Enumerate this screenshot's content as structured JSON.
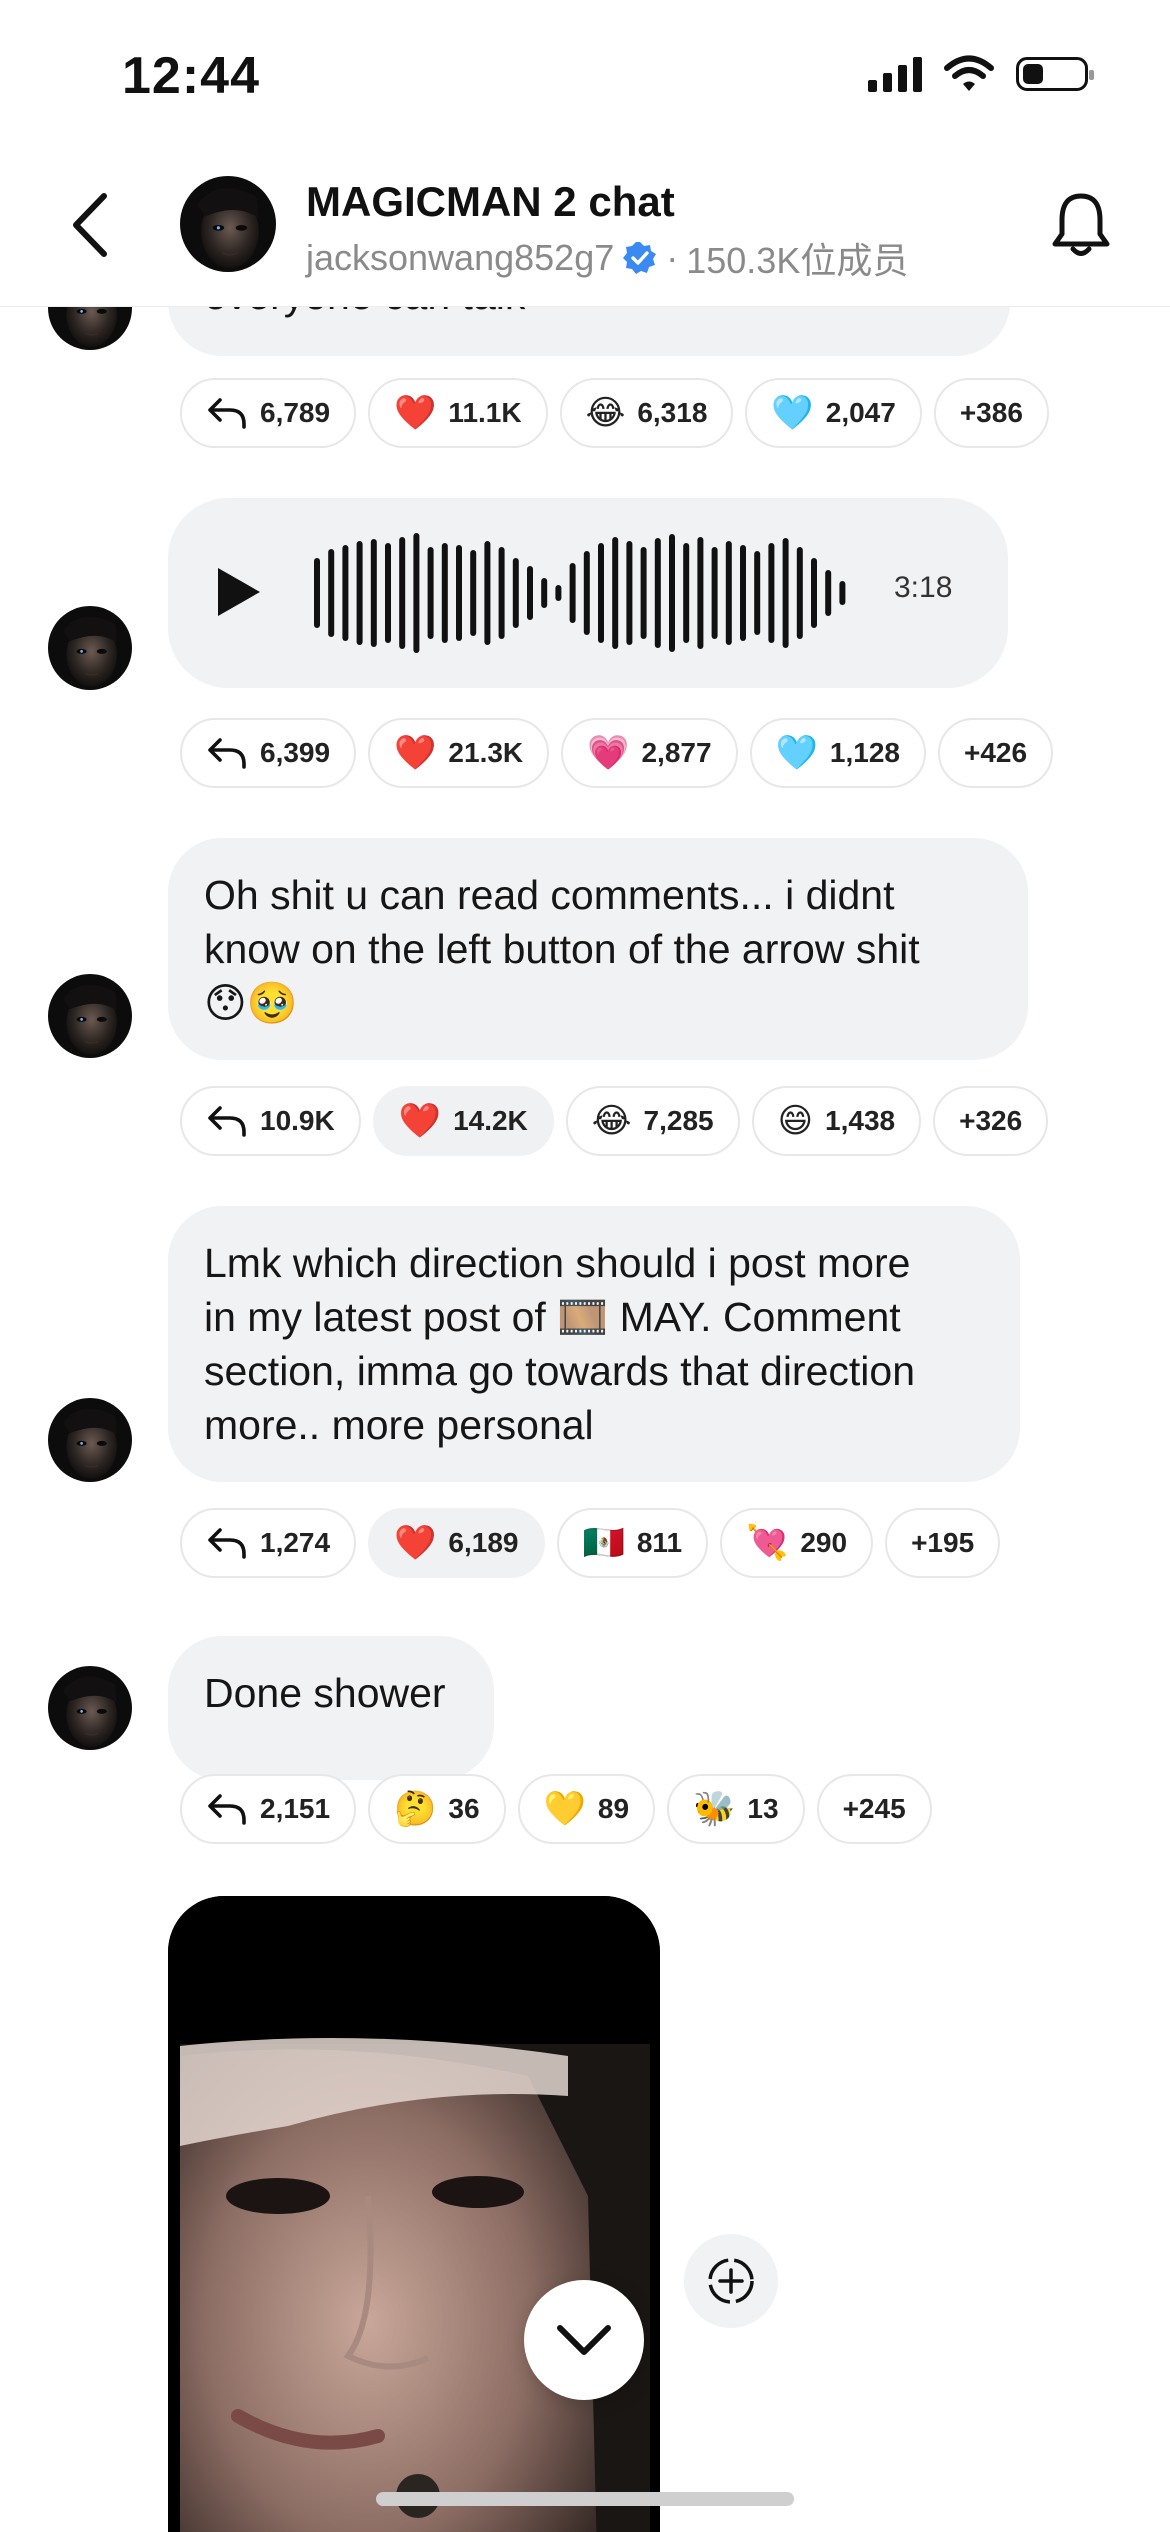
{
  "status": {
    "time": "12:44"
  },
  "header": {
    "title": "MAGICMAN 2 chat",
    "handle": "jacksonwang852g7",
    "separator": "·",
    "members": "150.3K位成员"
  },
  "messages": [
    {
      "type": "text",
      "partial_text": "everyone can talk",
      "reactions": {
        "reply": "6,789",
        "items": [
          {
            "emoji": "❤️",
            "count": "11.1K"
          },
          {
            "emoji": "😂",
            "count": "6,318"
          },
          {
            "emoji": "🩵",
            "count": "2,047"
          }
        ],
        "more": "+386"
      }
    },
    {
      "type": "voice",
      "duration": "3:18",
      "reactions": {
        "reply": "6,399",
        "items": [
          {
            "emoji": "❤️",
            "count": "21.3K"
          },
          {
            "emoji": "💗",
            "count": "2,877"
          },
          {
            "emoji": "🩵",
            "count": "1,128"
          }
        ],
        "more": "+426"
      }
    },
    {
      "type": "text",
      "line1": "Oh shit u can read comments... i didnt",
      "line2": "know on the left button of the arrow shit",
      "line3": "😯🥹",
      "reactions": {
        "reply": "10.9K",
        "items": [
          {
            "emoji": "❤️",
            "count": "14.2K"
          },
          {
            "emoji": "😂",
            "count": "7,285"
          },
          {
            "emoji": "😄",
            "count": "1,438"
          }
        ],
        "more": "+326"
      }
    },
    {
      "type": "text",
      "line1": "Lmk which direction should i post more",
      "line2": "in my latest post of 🎞️ MAY. Comment",
      "line3": "section, imma go towards that direction",
      "line4": "more.. more personal",
      "reactions": {
        "reply": "1,274",
        "items": [
          {
            "emoji": "❤️",
            "count": "6,189"
          },
          {
            "emoji": "🇲🇽",
            "count": "811"
          },
          {
            "emoji": "💘",
            "count": "290"
          }
        ],
        "more": "+195"
      }
    },
    {
      "type": "text",
      "line1": "Done shower",
      "reactions": {
        "reply": "2,151",
        "items": [
          {
            "emoji": "🤔",
            "count": "36"
          },
          {
            "emoji": "💛",
            "count": "89"
          },
          {
            "emoji": "🐝",
            "count": "13"
          }
        ],
        "more": "+245"
      }
    }
  ],
  "icons": [
    "back-chevron-icon",
    "bell-icon",
    "verified-badge-icon",
    "reply-arrow-icon",
    "play-icon",
    "waveform-icon",
    "add-reaction-icon",
    "scroll-down-chevron-icon"
  ],
  "colors": {
    "bubble_bg": "#f1f2f4",
    "verified_blue": "#3b8af2",
    "secondary_text": "#8a8a8a"
  }
}
